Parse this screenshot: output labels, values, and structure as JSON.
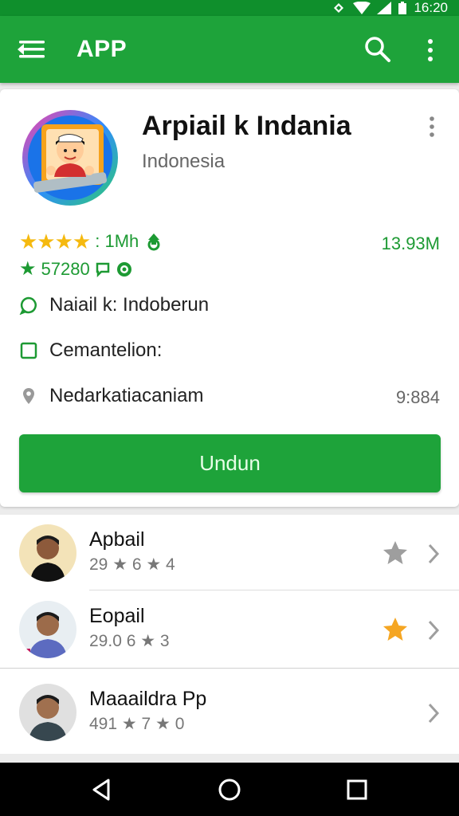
{
  "status_bar": {
    "time": "16:20"
  },
  "app_bar": {
    "title": "APP",
    "menu_icon": "hamburger-menu-icon",
    "search_icon": "search-icon",
    "more_icon": "more-vertical-icon"
  },
  "app": {
    "name": "Arpiail k Indania",
    "subtitle": "Indonesia",
    "stars": "★★★★",
    "downloads": ": 1Mh",
    "size": "13.93M",
    "reviews": "57280",
    "info": [
      {
        "icon": "chat-bubble-icon",
        "label": "Naiail k: Indoberun"
      },
      {
        "icon": "square-checkbox-icon",
        "label": "Cemantelion:"
      },
      {
        "icon": "location-pin-icon",
        "label": "Nedarkatiacaniam",
        "value": "9:884"
      }
    ],
    "install_label": "Undun"
  },
  "reviews_list": [
    {
      "name": "Apbail",
      "meta": "29 ★ 6 ★ 4",
      "favorite": false
    },
    {
      "name": "Eopail",
      "meta": "29.0 6 ★ 3",
      "favorite": true
    },
    {
      "name": "Maaaildra Pp",
      "meta": "491 ★ 7 ★ 0",
      "favorite": false
    }
  ],
  "colors": {
    "status_bar": "#0f8f2c",
    "app_bar": "#1ea33a",
    "accent_green": "#1d9a33",
    "star_yellow": "#f5b90f",
    "fav_orange": "#f5a623"
  }
}
